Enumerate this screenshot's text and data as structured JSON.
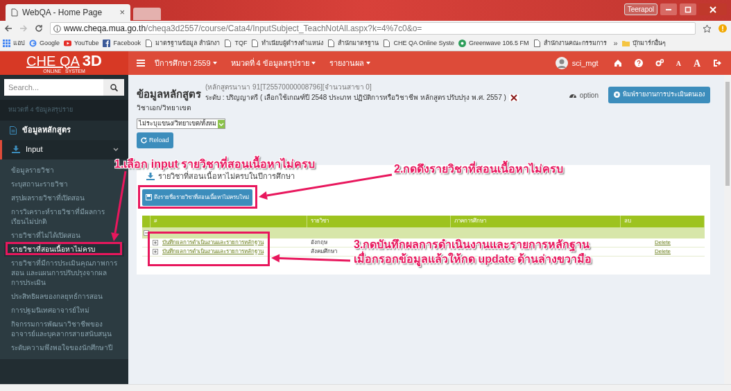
{
  "browser": {
    "tab_title": "WebQA - Home Page",
    "tab_close": "×",
    "user_badge": "Teerapol",
    "url_host": "www.cheqa.mua.go.th",
    "url_path": "/cheqa3d2557/course/Cata4/InputSubject_TeachNotAll.aspx?k=4%7c0&o=",
    "bookmarks": [
      {
        "kind": "apps",
        "label": "แอป"
      },
      {
        "kind": "google",
        "label": "Google"
      },
      {
        "kind": "youtube",
        "label": "YouTube"
      },
      {
        "kind": "facebook",
        "label": "Facebook"
      },
      {
        "kind": "page",
        "label": "มาตรฐานข้อมูล สำนักงา"
      },
      {
        "kind": "page",
        "label": "TQF"
      },
      {
        "kind": "page",
        "label": "ทำเนียบผู้ดำรงตำแหน่ง"
      },
      {
        "kind": "page",
        "label": "สำนักมาตรฐาน"
      },
      {
        "kind": "page",
        "label": "CHE QA Online Syste"
      },
      {
        "kind": "radio",
        "label": "Greenwave 106.5 FM"
      },
      {
        "kind": "page",
        "label": "สำนักงานคณะกรรมการ"
      },
      {
        "kind": "more",
        "label": "»"
      },
      {
        "kind": "folder",
        "label": "บุ๊กมาร์กอื่นๆ"
      }
    ]
  },
  "header": {
    "logo": "CHE QA",
    "logo_3d": "3D",
    "logo_sub": "ONLINE   SYSTEM",
    "menus": [
      "ปีการศึกษา 2559",
      "หมวดที่ 4 ข้อมูลสรุปราย",
      "รายงานผล"
    ],
    "user": "sci_mgt",
    "font_small": "A",
    "font_large": "A"
  },
  "sidebar": {
    "search_placeholder": "Search...",
    "section_label": "หมวดที่ 4 ข้อมูลสรุปราย",
    "items": [
      {
        "kind": "doc",
        "label": "ข้อมูลหลักสูตร"
      },
      {
        "kind": "group",
        "label": "Input",
        "expanded": true,
        "children": [
          {
            "label": "ข้อมูลรายวิชา",
            "selected": false
          },
          {
            "label": "ระบุสถานะรายวิชา",
            "selected": false
          },
          {
            "label": "สรุปผลรายวิชาที่เปิดสอน",
            "selected": false
          },
          {
            "label": "การวิเคราะห์รายวิชาที่มีผลการเรียนไม่ปกติ",
            "selected": false
          },
          {
            "label": "รายวิชาที่ไม่ได้เปิดสอน",
            "selected": false
          },
          {
            "label": "รายวิชาที่สอนเนื้อหาไม่ครบ",
            "selected": true
          },
          {
            "label": "รายวิชาที่มีการประเมินคุณภาพการสอน และแผนการปรับปรุงจากผลการประเมิน",
            "selected": false
          },
          {
            "label": "ประสิทธิผลของกลยุทธ์การสอน",
            "selected": false
          },
          {
            "label": "การปฐมนิเทศอาจารย์ใหม่",
            "selected": false
          },
          {
            "label": "กิจกรรมการพัฒนาวิชาชีพของอาจารย์และบุคลากรสายสนับสนุน",
            "selected": false
          },
          {
            "label": "ระดับความพึงพอใจของนักศึกษาปี",
            "selected": false
          }
        ]
      }
    ]
  },
  "main": {
    "title": "ข้อมูลหลักสูตร",
    "info_line_1": "(หลักสูตรนานา 91[T25570000008796][จำนวนสาขา 0]",
    "info_line_2": "ระดับ : ปริญญาตรี ( เลือกใช้เกณฑ์ปี 2548 ประเภท ปฏิบัติการหรือวิชาชีพ หลักสูตร ปรับปรุง พ.ศ. 2557 )",
    "subtitle": "วิชาเอก/วิทยาเขต",
    "option_label": "option",
    "print_button": "พิมพ์รายงานการประเมินตนเอง",
    "select_value": "ไม่ระบุแขนง/วิทยาเขต/ทั้งหม",
    "reload_button": "Reload",
    "panel": {
      "title": "รายวิชาที่สอนเนื้อหาไม่ครบในปีการศึกษา",
      "fetch_button": "ดึงรายชื่อรายวิชาที่สอนเนื้อหาไม่ครบใหม่",
      "table": {
        "columns": [
          "",
          "#",
          "รายวิชา",
          "ภาคการศึกษา",
          "ลบ"
        ],
        "rows": [
          {
            "link": "บันทึกผลการดำเนินงานและรายการหลักฐาน",
            "course": "อังกฤษ",
            "action": "Delete"
          },
          {
            "link": "บันทึกผลการดำเนินงานและรายการหลักฐาน",
            "course": "สังคมศึกษา",
            "action": "Delete"
          }
        ]
      }
    }
  },
  "annotations": [
    {
      "lines": [
        "1.เลือก input รายวิชาที่สอนเนื้อหาไม่ครบ"
      ]
    },
    {
      "lines": [
        "2.กดดึงรายวิชาที่สอนเนื้อหาไม่ครบ"
      ]
    },
    {
      "lines": [
        "3.กดบันทึกผลการดำเนินงานและรายการหลักฐาน",
        "เมื่อกรอกข้อมูลแล้วให้กด update ด้านล่างขวามือ"
      ]
    }
  ]
}
